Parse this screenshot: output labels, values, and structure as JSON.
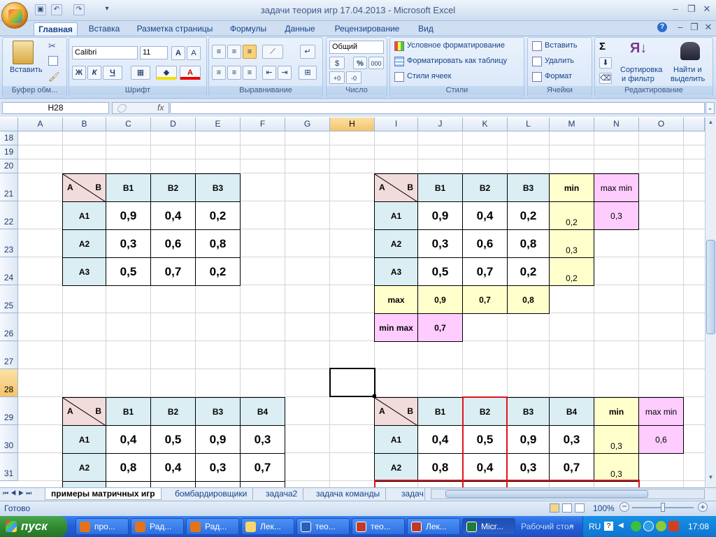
{
  "window": {
    "title": "задачи теория игр 17.04.2013 - Microsoft Excel"
  },
  "tabs": [
    {
      "label": "Главная"
    },
    {
      "label": "Вставка"
    },
    {
      "label": "Разметка страницы"
    },
    {
      "label": "Формулы"
    },
    {
      "label": "Данные"
    },
    {
      "label": "Рецензирование"
    },
    {
      "label": "Вид"
    }
  ],
  "ribbon": {
    "clipboard": {
      "label": "Буфер обм...",
      "paste": "Вставить"
    },
    "font": {
      "label": "Шрифт",
      "name": "Calibri",
      "size": "11",
      "bold": "Ж",
      "italic": "К",
      "underline": "Ч"
    },
    "alignment": {
      "label": "Выравнивание"
    },
    "number": {
      "label": "Число",
      "format": "Общий",
      "percent": "%",
      "thousands": "000"
    },
    "styles": {
      "label": "Стили",
      "conditional": "Условное форматирование",
      "as_table": "Форматировать как таблицу",
      "cell_styles": "Стили ячеек"
    },
    "cells": {
      "label": "Ячейки",
      "insert": "Вставить",
      "delete": "Удалить",
      "format": "Формат"
    },
    "editing": {
      "label": "Редактирование",
      "sum": "Σ",
      "sort1": "Сортировка",
      "sort2": "и фильтр",
      "find1": "Найти и",
      "find2": "выделить"
    }
  },
  "formula_bar": {
    "name_box": "H28",
    "fx": "fx",
    "value": ""
  },
  "columns": [
    "A",
    "B",
    "C",
    "D",
    "E",
    "F",
    "G",
    "H",
    "I",
    "J",
    "K",
    "L",
    "M",
    "N",
    "O"
  ],
  "rows": [
    "18",
    "19",
    "20",
    "21",
    "22",
    "23",
    "24",
    "25",
    "26",
    "27",
    "28",
    "29",
    "30",
    "31"
  ],
  "tables": {
    "t1": {
      "corner_a": "A",
      "corner_b": "B",
      "headers": [
        "B1",
        "B2",
        "B3"
      ],
      "rows": [
        {
          "label": "A1",
          "values": [
            "0,9",
            "0,4",
            "0,2"
          ]
        },
        {
          "label": "A2",
          "values": [
            "0,3",
            "0,6",
            "0,8"
          ]
        },
        {
          "label": "A3",
          "values": [
            "0,5",
            "0,7",
            "0,2"
          ]
        }
      ]
    },
    "t2": {
      "corner_a": "A",
      "corner_b": "B",
      "headers": [
        "B1",
        "B2",
        "B3"
      ],
      "min_header": "min",
      "maxmin_header": "max min",
      "rows": [
        {
          "label": "A1",
          "values": [
            "0,9",
            "0,4",
            "0,2"
          ],
          "min": "0,2"
        },
        {
          "label": "A2",
          "values": [
            "0,3",
            "0,6",
            "0,8"
          ],
          "min": "0,3"
        },
        {
          "label": "A3",
          "values": [
            "0,5",
            "0,7",
            "0,2"
          ],
          "min": "0,2"
        }
      ],
      "maxmin_value": "0,3",
      "max_label": "max",
      "max_values": [
        "0,9",
        "0,7",
        "0,8"
      ],
      "minmax_label": "min max",
      "minmax_value": "0,7"
    },
    "t3": {
      "corner_a": "A",
      "corner_b": "B",
      "headers": [
        "B1",
        "B2",
        "B3",
        "B4"
      ],
      "rows": [
        {
          "label": "A1",
          "values": [
            "0,4",
            "0,5",
            "0,9",
            "0,3"
          ]
        },
        {
          "label": "A2",
          "values": [
            "0,8",
            "0,4",
            "0,3",
            "0,7"
          ]
        }
      ]
    },
    "t4": {
      "corner_a": "A",
      "corner_b": "B",
      "headers": [
        "B1",
        "B2",
        "B3",
        "B4"
      ],
      "min_header": "min",
      "maxmin_header": "max min",
      "rows": [
        {
          "label": "A1",
          "values": [
            "0,4",
            "0,5",
            "0,9",
            "0,3"
          ],
          "min": "0,3"
        },
        {
          "label": "A2",
          "values": [
            "0,8",
            "0,4",
            "0,3",
            "0,7"
          ],
          "min": "0,3"
        }
      ],
      "maxmin_value": "0,6"
    }
  },
  "sheets": [
    {
      "label": "примеры матричных игр"
    },
    {
      "label": "бомбардировщики"
    },
    {
      "label": "задача2"
    },
    {
      "label": "задача команды"
    },
    {
      "label": "задач"
    }
  ],
  "status": {
    "ready": "Готово",
    "zoom": "100%"
  },
  "taskbar": {
    "start": "пуск",
    "items": [
      {
        "label": "про..."
      },
      {
        "label": "Рад..."
      },
      {
        "label": "Рад..."
      },
      {
        "label": "Лек..."
      },
      {
        "label": "тео..."
      },
      {
        "label": "тео..."
      },
      {
        "label": "Лек..."
      },
      {
        "label": "Micr..."
      }
    ],
    "desktop": "Рабочий стол",
    "lang": "RU",
    "time": "17:08"
  }
}
